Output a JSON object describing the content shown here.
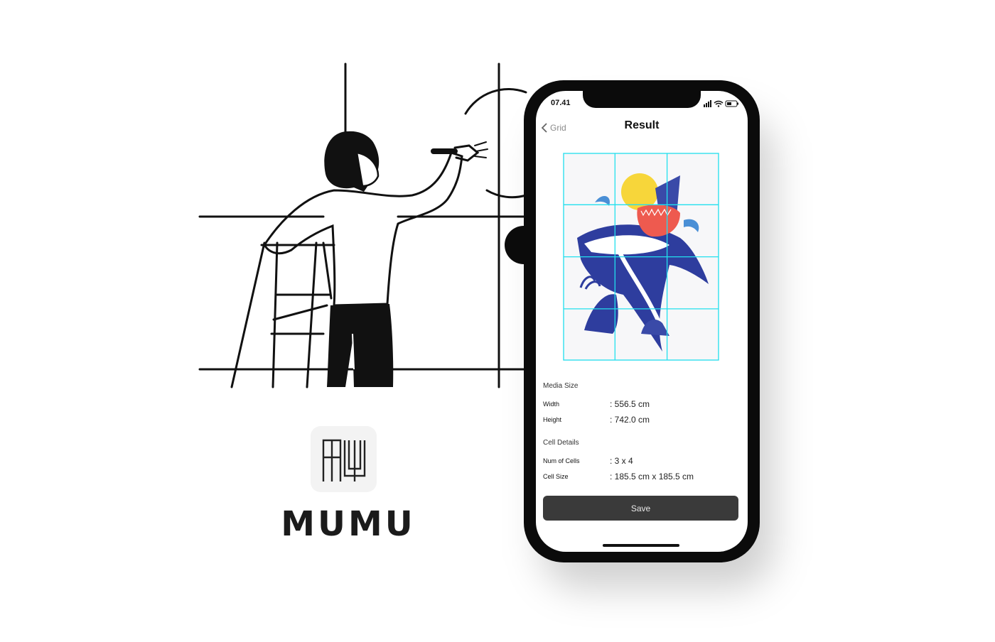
{
  "status_bar": {
    "time": "07.41"
  },
  "nav": {
    "back_label": "Grid",
    "title": "Result"
  },
  "artwork": {
    "grid": {
      "columns": 3,
      "rows": 4
    },
    "grid_color": "#22e0ee"
  },
  "media_size": {
    "section_title": "Media Size",
    "rows": [
      {
        "label": "Width",
        "value": ": 556.5 cm"
      },
      {
        "label": "Height",
        "value": ": 742.0 cm"
      }
    ]
  },
  "cell_details": {
    "section_title": "Cell Details",
    "rows": [
      {
        "label": "Num of Cells",
        "value": ": 3 x 4"
      },
      {
        "label": "Cell Size",
        "value": ": 185.5 cm x 185.5 cm"
      }
    ]
  },
  "actions": {
    "save_label": "Save"
  },
  "brand": {
    "name": "MUMU"
  },
  "colors": {
    "phone_body": "#0b0b0b",
    "save_button": "#3a3a3a",
    "accent_blue": "#2e3d9e",
    "accent_red": "#ee5a4f",
    "accent_yellow": "#f7d63a"
  }
}
